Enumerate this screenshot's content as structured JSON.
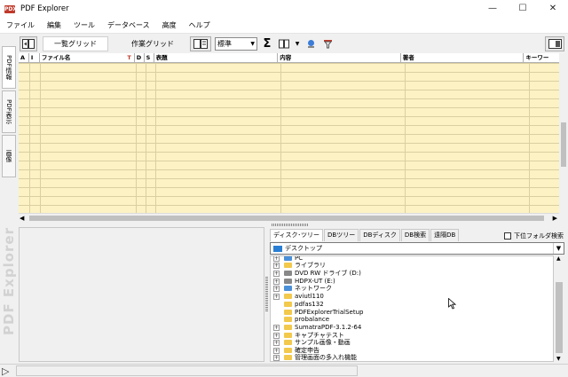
{
  "window": {
    "title": "PDF Explorer",
    "icon_label": "PDX",
    "controls": {
      "minimize": "—",
      "maximize": "☐",
      "close": "✕"
    }
  },
  "menu": [
    "ファイル",
    "編集",
    "ツール",
    "データベース",
    "高度",
    "ヘルプ"
  ],
  "toolbar": {
    "view_tabs": [
      "一覧グリッド",
      "作業グリッド"
    ],
    "layout_select": "標準",
    "sigma": "Σ"
  },
  "sidetabs": [
    "PDF情報",
    "PDF表示",
    "画像"
  ],
  "brand": "PDF Explorer",
  "grid": {
    "columns": [
      {
        "key": "a",
        "label": "A"
      },
      {
        "key": "i",
        "label": "I"
      },
      {
        "key": "filename",
        "label": "ファイル名"
      },
      {
        "key": "d",
        "label": "D"
      },
      {
        "key": "s",
        "label": "S"
      },
      {
        "key": "title",
        "label": "表題"
      },
      {
        "key": "content",
        "label": "内容"
      },
      {
        "key": "author",
        "label": "著者"
      },
      {
        "key": "keyword",
        "label": "キーワー"
      }
    ],
    "sort_marker": "T"
  },
  "tree_panel": {
    "tabs": [
      "ディスク･ツリー",
      "DBツリー",
      "DBディスク",
      "DB検索",
      "遠隔DB"
    ],
    "subfolder_search": "下位フォルダ検索",
    "drive": "デスクトップ",
    "items": [
      {
        "label": "PC",
        "icon": "pc-icon",
        "expandable": true
      },
      {
        "label": "ライブラリ",
        "icon": "folder-icon",
        "expandable": true
      },
      {
        "label": "DVD RW ドライブ (D:)",
        "icon": "drive-icon",
        "expandable": true
      },
      {
        "label": "HDPX-UT (E:)",
        "icon": "drive-icon",
        "expandable": true
      },
      {
        "label": "ネットワーク",
        "icon": "network-icon",
        "expandable": true
      },
      {
        "label": "aviutl110",
        "icon": "folder-icon",
        "expandable": true
      },
      {
        "label": "pdfas132",
        "icon": "folder-icon",
        "expandable": false
      },
      {
        "label": "PDFExplorerTrialSetup",
        "icon": "folder-icon",
        "expandable": false
      },
      {
        "label": "probalance",
        "icon": "folder-icon",
        "expandable": false
      },
      {
        "label": "SumatraPDF-3.1.2-64",
        "icon": "folder-icon",
        "expandable": true
      },
      {
        "label": "キャプチャテスト",
        "icon": "folder-icon",
        "expandable": true
      },
      {
        "label": "サンプル画像・動画",
        "icon": "folder-icon",
        "expandable": true
      },
      {
        "label": "確定申告",
        "icon": "folder-icon",
        "expandable": true
      },
      {
        "label": "管理画面の多入れ機能",
        "icon": "folder-icon",
        "expandable": true
      }
    ]
  }
}
